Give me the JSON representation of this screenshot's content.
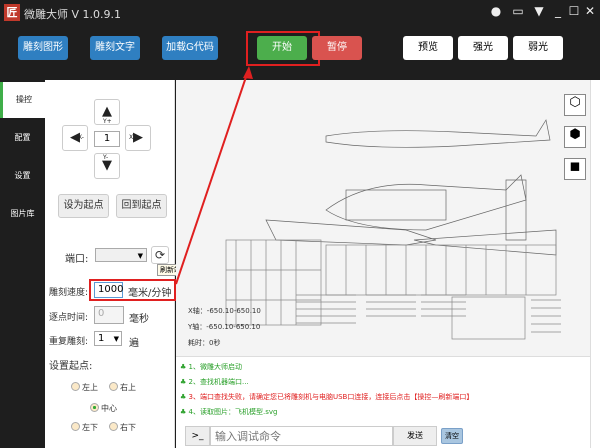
{
  "title_bar": {
    "app_title": "微雕大师 V 1.0.9.1",
    "logo_char": "匠"
  },
  "toolbar": {
    "engrave_shape": "雕刻图形",
    "engrave_text": "雕刻文字",
    "load_gcode": "加载G代码",
    "start": "开始",
    "pause": "暂停",
    "preview": "预览",
    "strong_light": "强光",
    "weak_light": "弱光"
  },
  "tabs": [
    "操控",
    "配置",
    "设置",
    "图片库"
  ],
  "control": {
    "y_plus": "Y+",
    "y_minus": "Y-",
    "x_plus": "X+",
    "x_minus": "X-",
    "step": "1",
    "set_origin": "设为起点",
    "go_origin": "回到起点",
    "port_label": "端口:",
    "port_value": "",
    "refresh_tooltip": "刷新端口",
    "speed_label": "雕刻速度:",
    "speed_value": "1000",
    "speed_unit": "毫米/分钟",
    "dot_label": "逐点时间:",
    "dot_value": "0",
    "dot_unit": "毫秒",
    "repeat_label": "重复雕刻:",
    "repeat_value": "1",
    "repeat_unit": "遍",
    "origin_label": "设置起点:",
    "origins": [
      "左上",
      "右上",
      "中心",
      "左下",
      "右下"
    ],
    "selected_origin": "中心"
  },
  "canvas_info": {
    "x_axis": "X轴：-650.10-650.10",
    "y_axis": "Y轴：-650.10-650.10",
    "time": "耗时：0秒"
  },
  "log": [
    {
      "text": "1、微雕大师启动",
      "color": "#2aa02a"
    },
    {
      "text": "2、查找机器端口...",
      "color": "#2aa02a"
    },
    {
      "text": "3、端口查找失败，请确定您已将雕刻机与电脑USB口连接，连接后点击【操控—刷新端口】",
      "color": "#e02020"
    },
    {
      "text": "4、读取图片：飞机模型.svg",
      "color": "#2aa02a"
    }
  ],
  "command": {
    "prompt": ">_",
    "placeholder": "输入调试命令",
    "send": "发送",
    "clear": "清空"
  }
}
